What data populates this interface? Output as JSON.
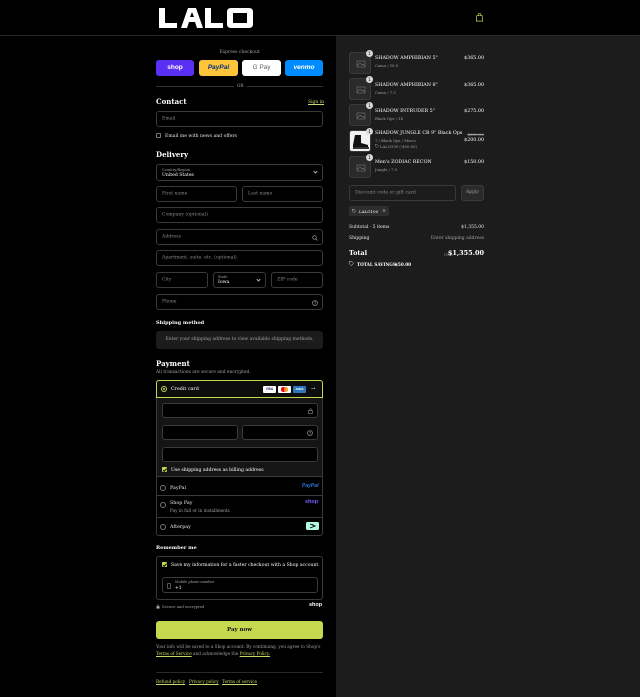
{
  "header": {
    "brand": "LALO",
    "cart_icon": "shopping-bag-icon"
  },
  "express": {
    "title": "Express checkout",
    "buttons": [
      "shop",
      "PayPal",
      "G Pay",
      "venmo"
    ],
    "or": "OR"
  },
  "contact": {
    "title": "Contact",
    "sign_in": "Sign in",
    "email_placeholder": "Email",
    "news_label": "Email me with news and offers"
  },
  "delivery": {
    "title": "Delivery",
    "country_label": "Country/Region",
    "country_value": "United States",
    "first_name": "First name",
    "last_name": "Last name",
    "company": "Company (optional)",
    "address": "Address",
    "apartment": "Apartment, suite, etc. (optional)",
    "city": "City",
    "state_label": "State",
    "state_value": "Iowa",
    "zip": "ZIP code",
    "phone": "Phone"
  },
  "shipping": {
    "title": "Shipping method",
    "message": "Enter your shipping address to view available shipping methods."
  },
  "payment": {
    "title": "Payment",
    "subtitle": "All transactions are secure and encrypted.",
    "credit_card": "Credit card",
    "card_brands": [
      "VISA",
      "MC",
      "AMEX"
    ],
    "billing_label": "Use shipping address as billing address",
    "paypal": "PayPal",
    "paypal_logo": "PayPal",
    "shop_pay": "Shop Pay",
    "shop_pay_sub": "Pay in full or in installments",
    "shop_pay_logo": "shop",
    "afterpay": "Afterpay"
  },
  "remember": {
    "title": "Remember me",
    "save_label": "Save my information for a faster checkout with a Shop account",
    "mobile_label": "Mobile phone number",
    "mobile_value": "+1",
    "secure": "Secure and encrypted",
    "shop_logo": "shop"
  },
  "pay_now": "Pay now",
  "legal": {
    "line1": "Your info will be saved to a Shop account. By continuing, you agree to Shop's",
    "tos": "Terms of Service",
    "and": "and acknowledge the",
    "privacy": "Privacy Policy."
  },
  "footer": [
    "Refund policy",
    "Privacy policy",
    "Terms of service"
  ],
  "cart": {
    "items": [
      {
        "qty": "1",
        "name": "SHADOW AMPHIBIAN 5\"",
        "variant": "Camo / 10.5",
        "price": "$365.00"
      },
      {
        "qty": "1",
        "name": "SHADOW AMPHIBIAN 8\"",
        "variant": "Camo / 7.5",
        "price": "$365.00"
      },
      {
        "qty": "1",
        "name": "SHADOW INTRUDER 5\"",
        "variant": "Black Ops / 14",
        "price": "$275.00"
      },
      {
        "qty": "1",
        "name": "SHADOW JUNGLE CB 9\" Black Ops",
        "variant": "7 / Black Ops / Men's",
        "discount": "LALO100 (-$50.00)",
        "old_price": "$250.00",
        "price": "$200.00"
      },
      {
        "qty": "1",
        "name": "Men's ZODIAC RECON",
        "variant": "Jungle / 7.5",
        "price": "$150.00"
      }
    ],
    "discount_placeholder": "Discount code or gift card",
    "apply": "Apply",
    "code_tag": "LALO100",
    "subtotal_label": "Subtotal · 5 items",
    "subtotal_value": "$1,355.00",
    "shipping_label": "Shipping",
    "shipping_value": "Enter shipping address",
    "total_label": "Total",
    "currency": "USD",
    "total_value": "$1,355.00",
    "savings_label": "TOTAL SAVINGS",
    "savings_value": "$50.00"
  }
}
